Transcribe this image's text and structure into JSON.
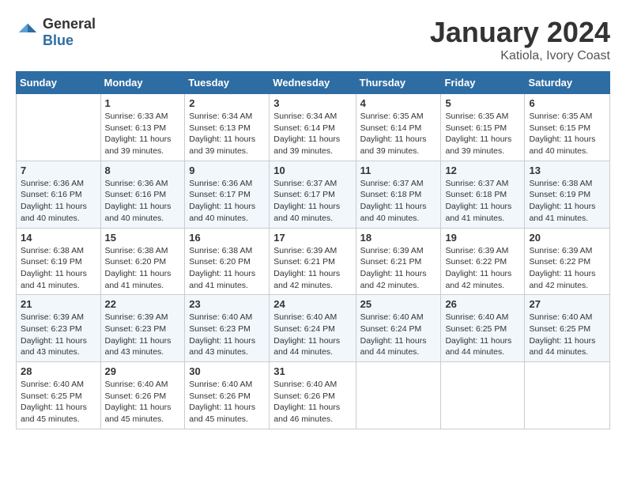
{
  "logo": {
    "general": "General",
    "blue": "Blue"
  },
  "header": {
    "title": "January 2024",
    "subtitle": "Katiola, Ivory Coast"
  },
  "weekdays": [
    "Sunday",
    "Monday",
    "Tuesday",
    "Wednesday",
    "Thursday",
    "Friday",
    "Saturday"
  ],
  "weeks": [
    [
      {
        "day": "",
        "info": ""
      },
      {
        "day": "1",
        "info": "Sunrise: 6:33 AM\nSunset: 6:13 PM\nDaylight: 11 hours and 39 minutes."
      },
      {
        "day": "2",
        "info": "Sunrise: 6:34 AM\nSunset: 6:13 PM\nDaylight: 11 hours and 39 minutes."
      },
      {
        "day": "3",
        "info": "Sunrise: 6:34 AM\nSunset: 6:14 PM\nDaylight: 11 hours and 39 minutes."
      },
      {
        "day": "4",
        "info": "Sunrise: 6:35 AM\nSunset: 6:14 PM\nDaylight: 11 hours and 39 minutes."
      },
      {
        "day": "5",
        "info": "Sunrise: 6:35 AM\nSunset: 6:15 PM\nDaylight: 11 hours and 39 minutes."
      },
      {
        "day": "6",
        "info": "Sunrise: 6:35 AM\nSunset: 6:15 PM\nDaylight: 11 hours and 40 minutes."
      }
    ],
    [
      {
        "day": "7",
        "info": "Sunrise: 6:36 AM\nSunset: 6:16 PM\nDaylight: 11 hours and 40 minutes."
      },
      {
        "day": "8",
        "info": "Sunrise: 6:36 AM\nSunset: 6:16 PM\nDaylight: 11 hours and 40 minutes."
      },
      {
        "day": "9",
        "info": "Sunrise: 6:36 AM\nSunset: 6:17 PM\nDaylight: 11 hours and 40 minutes."
      },
      {
        "day": "10",
        "info": "Sunrise: 6:37 AM\nSunset: 6:17 PM\nDaylight: 11 hours and 40 minutes."
      },
      {
        "day": "11",
        "info": "Sunrise: 6:37 AM\nSunset: 6:18 PM\nDaylight: 11 hours and 40 minutes."
      },
      {
        "day": "12",
        "info": "Sunrise: 6:37 AM\nSunset: 6:18 PM\nDaylight: 11 hours and 41 minutes."
      },
      {
        "day": "13",
        "info": "Sunrise: 6:38 AM\nSunset: 6:19 PM\nDaylight: 11 hours and 41 minutes."
      }
    ],
    [
      {
        "day": "14",
        "info": "Sunrise: 6:38 AM\nSunset: 6:19 PM\nDaylight: 11 hours and 41 minutes."
      },
      {
        "day": "15",
        "info": "Sunrise: 6:38 AM\nSunset: 6:20 PM\nDaylight: 11 hours and 41 minutes."
      },
      {
        "day": "16",
        "info": "Sunrise: 6:38 AM\nSunset: 6:20 PM\nDaylight: 11 hours and 41 minutes."
      },
      {
        "day": "17",
        "info": "Sunrise: 6:39 AM\nSunset: 6:21 PM\nDaylight: 11 hours and 42 minutes."
      },
      {
        "day": "18",
        "info": "Sunrise: 6:39 AM\nSunset: 6:21 PM\nDaylight: 11 hours and 42 minutes."
      },
      {
        "day": "19",
        "info": "Sunrise: 6:39 AM\nSunset: 6:22 PM\nDaylight: 11 hours and 42 minutes."
      },
      {
        "day": "20",
        "info": "Sunrise: 6:39 AM\nSunset: 6:22 PM\nDaylight: 11 hours and 42 minutes."
      }
    ],
    [
      {
        "day": "21",
        "info": "Sunrise: 6:39 AM\nSunset: 6:23 PM\nDaylight: 11 hours and 43 minutes."
      },
      {
        "day": "22",
        "info": "Sunrise: 6:39 AM\nSunset: 6:23 PM\nDaylight: 11 hours and 43 minutes."
      },
      {
        "day": "23",
        "info": "Sunrise: 6:40 AM\nSunset: 6:23 PM\nDaylight: 11 hours and 43 minutes."
      },
      {
        "day": "24",
        "info": "Sunrise: 6:40 AM\nSunset: 6:24 PM\nDaylight: 11 hours and 44 minutes."
      },
      {
        "day": "25",
        "info": "Sunrise: 6:40 AM\nSunset: 6:24 PM\nDaylight: 11 hours and 44 minutes."
      },
      {
        "day": "26",
        "info": "Sunrise: 6:40 AM\nSunset: 6:25 PM\nDaylight: 11 hours and 44 minutes."
      },
      {
        "day": "27",
        "info": "Sunrise: 6:40 AM\nSunset: 6:25 PM\nDaylight: 11 hours and 44 minutes."
      }
    ],
    [
      {
        "day": "28",
        "info": "Sunrise: 6:40 AM\nSunset: 6:25 PM\nDaylight: 11 hours and 45 minutes."
      },
      {
        "day": "29",
        "info": "Sunrise: 6:40 AM\nSunset: 6:26 PM\nDaylight: 11 hours and 45 minutes."
      },
      {
        "day": "30",
        "info": "Sunrise: 6:40 AM\nSunset: 6:26 PM\nDaylight: 11 hours and 45 minutes."
      },
      {
        "day": "31",
        "info": "Sunrise: 6:40 AM\nSunset: 6:26 PM\nDaylight: 11 hours and 46 minutes."
      },
      {
        "day": "",
        "info": ""
      },
      {
        "day": "",
        "info": ""
      },
      {
        "day": "",
        "info": ""
      }
    ]
  ]
}
